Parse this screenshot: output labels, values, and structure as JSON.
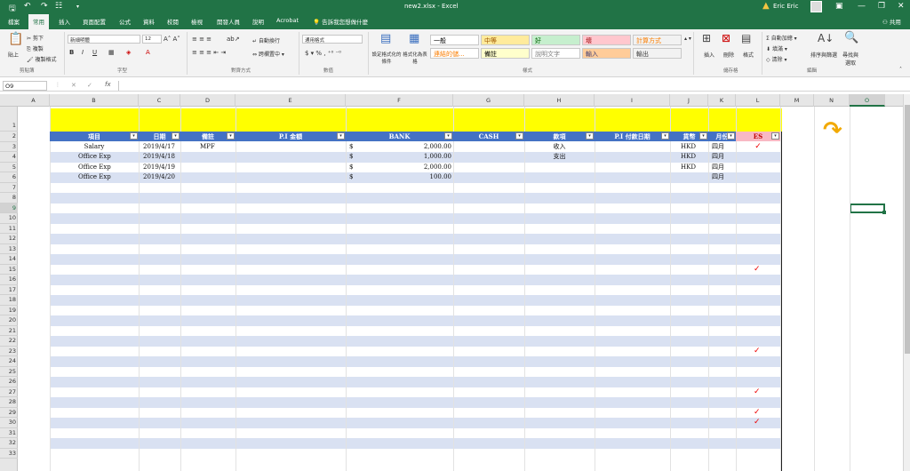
{
  "window": {
    "title": "new2.xlsx - Excel",
    "user": "Eric Eric"
  },
  "tabs": [
    "檔案",
    "常用",
    "插入",
    "頁面配置",
    "公式",
    "資料",
    "校閱",
    "檢視",
    "開發人員",
    "說明",
    "Acrobat"
  ],
  "tell_me": "告訴我您想做什麼",
  "share": "共用",
  "ribbon": {
    "clipboard": {
      "paste": "貼上",
      "cut": "剪下",
      "copy": "複製",
      "format_painter": "複製格式",
      "group": "剪貼簿"
    },
    "font": {
      "name": "新細明體",
      "size": "12",
      "group": "字型"
    },
    "alignment": {
      "wrap": "自動換行",
      "merge": "跨欄置中",
      "group": "對齊方式"
    },
    "number": {
      "format": "通用格式",
      "group": "數值"
    },
    "styles": {
      "conditional": "設定格式化的條件",
      "as_table": "格式化為表格",
      "cells": [
        {
          "label": "一般",
          "bg": "#ffffff",
          "fg": "#000000"
        },
        {
          "label": "中等",
          "bg": "#ffeb9c",
          "fg": "#9c5700"
        },
        {
          "label": "好",
          "bg": "#c6efce",
          "fg": "#006100"
        },
        {
          "label": "壞",
          "bg": "#ffc7ce",
          "fg": "#9c0006"
        },
        {
          "label": "計算方式",
          "bg": "#f2f2f2",
          "fg": "#fa7d00"
        },
        {
          "label": "連結的儲...",
          "bg": "#ffffff",
          "fg": "#fa7d00"
        },
        {
          "label": "備註",
          "bg": "#ffffcc",
          "fg": "#000000"
        },
        {
          "label": "說明文字",
          "bg": "#ffffff",
          "fg": "#7f7f7f"
        },
        {
          "label": "輸入",
          "bg": "#ffcc99",
          "fg": "#3f3f76"
        },
        {
          "label": "輸出",
          "bg": "#f2f2f2",
          "fg": "#3f3f3f"
        }
      ],
      "group": "樣式"
    },
    "cells_group": {
      "insert": "插入",
      "delete": "刪除",
      "format": "格式",
      "group": "儲存格"
    },
    "editing": {
      "autosum": "自動加總",
      "fill": "填滿",
      "clear": "清除",
      "sort": "排序與篩選",
      "find": "尋找與選取",
      "group": "編輯"
    }
  },
  "formula_bar": {
    "name_box": "O9",
    "fx": "fx",
    "value": ""
  },
  "columns": [
    "A",
    "B",
    "C",
    "D",
    "E",
    "F",
    "G",
    "H",
    "I",
    "J",
    "K",
    "L",
    "M",
    "N",
    "O"
  ],
  "rows": [
    "1",
    "2",
    "3",
    "4",
    "5",
    "6",
    "7",
    "8",
    "9",
    "10",
    "11",
    "12",
    "13",
    "14",
    "15",
    "16",
    "17",
    "18",
    "19",
    "20",
    "21",
    "22",
    "23",
    "24",
    "25",
    "26",
    "27",
    "28",
    "29",
    "30",
    "31",
    "32",
    "33"
  ],
  "table": {
    "headers": [
      "項目",
      "日期",
      "備註",
      "P.I 金額",
      "BANK",
      "CASH",
      "款項",
      "P.I 付款日期",
      "貨幣",
      "月份",
      "ES"
    ],
    "rows": [
      {
        "item": "Salary",
        "date": "2019/4/17",
        "note": "MPF",
        "bank_sym": "$",
        "bank": "2,000.00",
        "kind": "收入",
        "currency": "HKD",
        "month": "四月",
        "es": "✓"
      },
      {
        "item": "Office Exp",
        "date": "2019/4/18",
        "note": "",
        "bank_sym": "$",
        "bank": "1,000.00",
        "kind": "支出",
        "currency": "HKD",
        "month": "四月",
        "es": ""
      },
      {
        "item": "Office Exp",
        "date": "2019/4/19",
        "note": "",
        "bank_sym": "$",
        "bank": "2,000.00",
        "kind": "",
        "currency": "HKD",
        "month": "四月",
        "es": ""
      },
      {
        "item": "Office Exp",
        "date": "2019/4/20",
        "note": "",
        "bank_sym": "$",
        "bank": "100.00",
        "kind": "",
        "currency": "",
        "month": "四月",
        "es": ""
      }
    ],
    "extra_checks_rows": [
      "15",
      "23",
      "27",
      "29",
      "30"
    ],
    "check_mark": "✓"
  },
  "colors": {
    "excel_green": "#217346",
    "header_blue": "#4472c4",
    "band": "#d9e1f2",
    "yellow": "#ffff00"
  }
}
